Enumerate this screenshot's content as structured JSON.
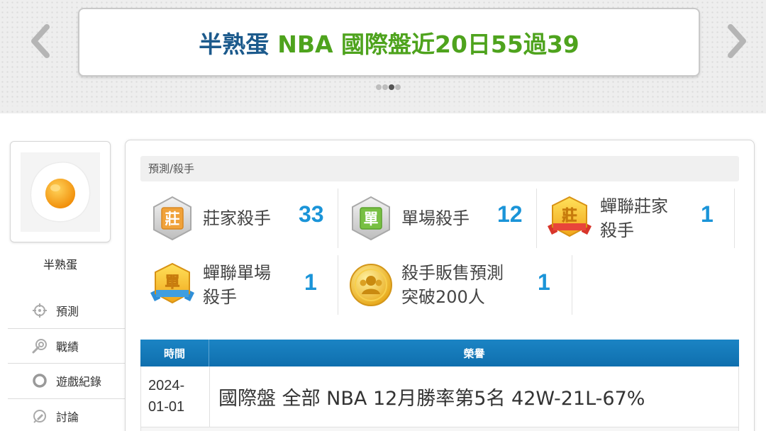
{
  "banner": {
    "name": "半熟蛋",
    "text": "NBA 國際盤近20日55過39",
    "prev_arrow": "‹",
    "next_arrow": "›",
    "name_color": "#1c5a8c",
    "text_color": "#4ea31d"
  },
  "profile": {
    "user_name": "半熟蛋",
    "avatar_icon": "fried-egg-icon"
  },
  "side_menu": {
    "items": [
      {
        "label": "預測",
        "icon": "crosshair-icon"
      },
      {
        "label": "戰績",
        "icon": "target-hand-icon"
      },
      {
        "label": "遊戲紀錄",
        "icon": "ring-icon"
      },
      {
        "label": "討論",
        "icon": "chat-pencil-icon"
      }
    ]
  },
  "section": {
    "title": "預測/殺手"
  },
  "badges": [
    {
      "label": "莊家殺手",
      "count": "33",
      "icon": "zhuang-silver-badge-icon"
    },
    {
      "label": "單場殺手",
      "count": "12",
      "icon": "dan-silver-badge-icon"
    },
    {
      "label_line1": "蟬聯莊家",
      "label_line2": "殺手",
      "count": "1",
      "icon": "zhuang-gold-ribbon-badge-icon"
    },
    {
      "label_line1": "蟬聯單場",
      "label_line2": "殺手",
      "count": "1",
      "icon": "dan-gold-ribbon-badge-icon"
    },
    {
      "label_line1": "殺手販售預測",
      "label_line2": "突破200人",
      "count": "1",
      "icon": "gold-people-medal-icon"
    }
  ],
  "honor_table": {
    "headers": {
      "time": "時間",
      "honor": "榮譽"
    },
    "rows": [
      {
        "date_line1": "2024-",
        "date_line2": "01-01",
        "honor": "國際盤 全部 NBA 12月勝率第5名 42W-21L-67%"
      }
    ]
  },
  "colors": {
    "accent_blue": "#1a94d8",
    "table_header": "#1b84c4"
  }
}
